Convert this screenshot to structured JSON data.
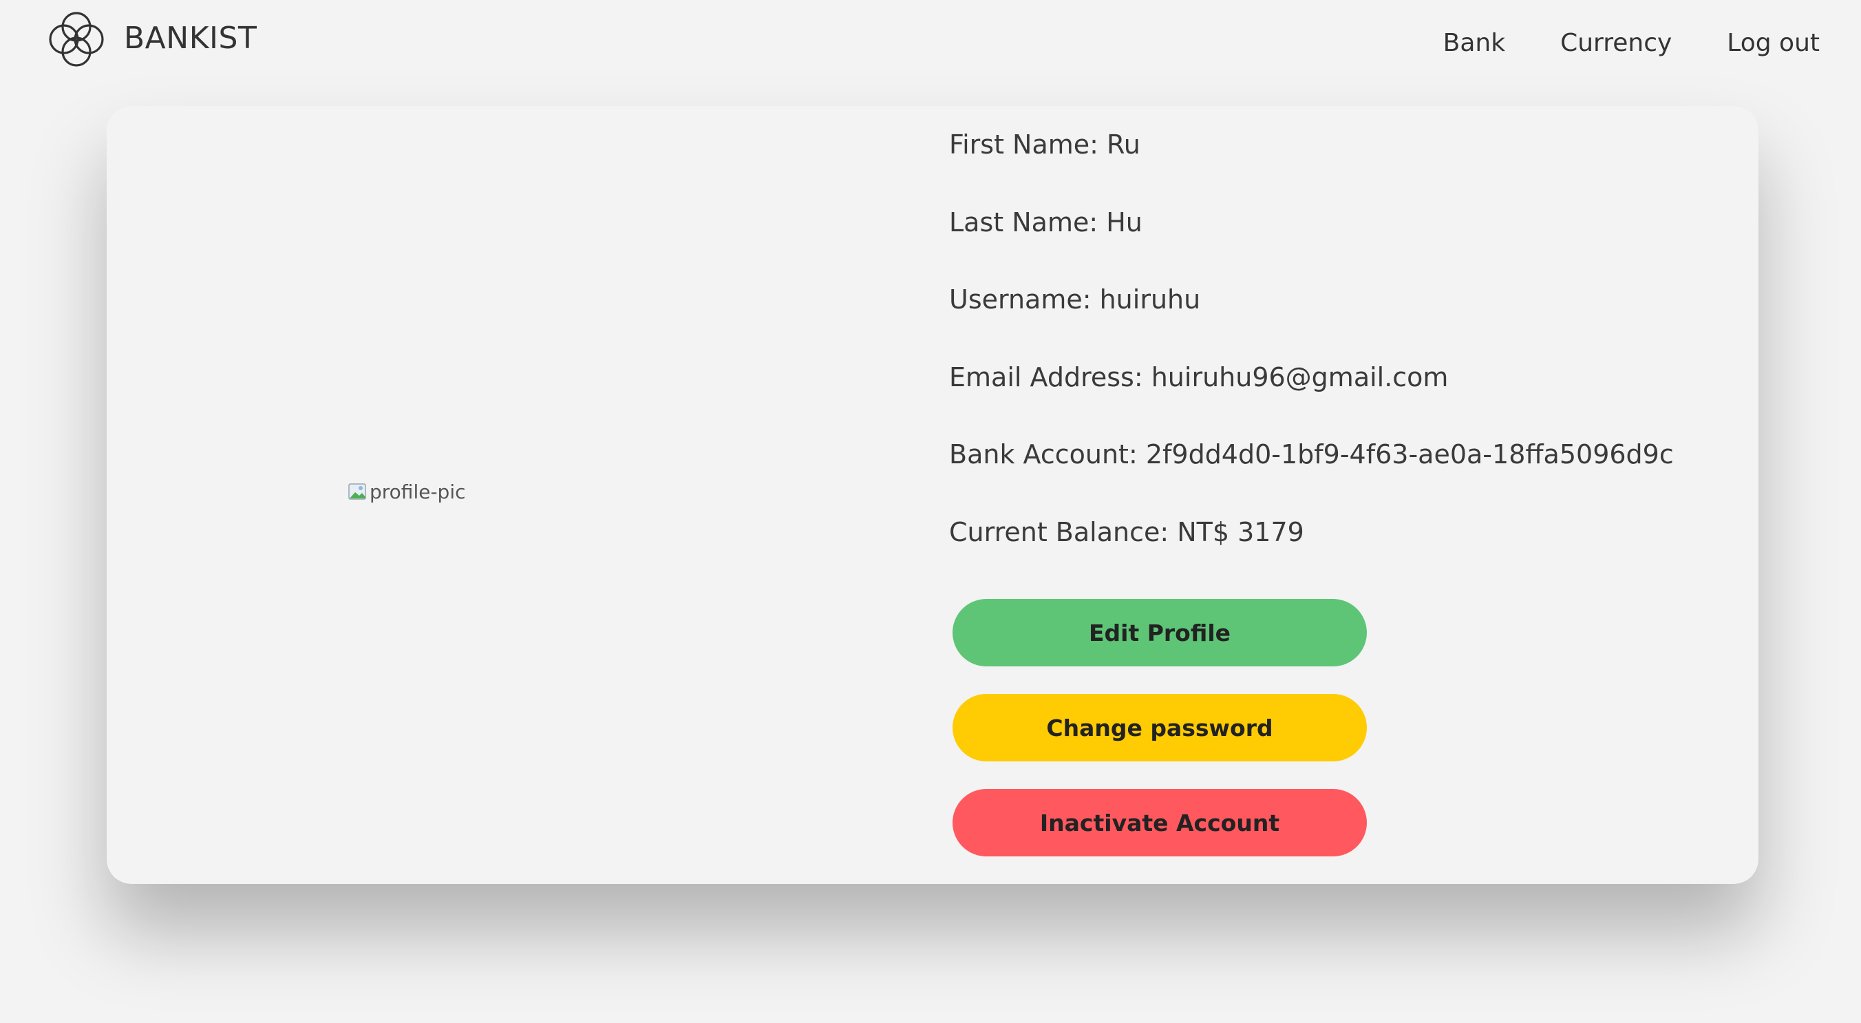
{
  "header": {
    "brand_name": "BANKIST",
    "nav": [
      {
        "label": "Bank"
      },
      {
        "label": "Currency"
      },
      {
        "label": "Log out"
      }
    ]
  },
  "profile": {
    "pic_alt": "profile-pic",
    "fields": [
      {
        "label": "First Name:",
        "value": "Ru"
      },
      {
        "label": "Last Name:",
        "value": "Hu"
      },
      {
        "label": "Username:",
        "value": "huiruhu"
      },
      {
        "label": "Email Address:",
        "value": "huiruhu96@gmail.com"
      },
      {
        "label": "Bank Account:",
        "value": "2f9dd4d0-1bf9-4f63-ae0a-18ffa5096d9c"
      },
      {
        "label": "Current Balance:",
        "value": "NT$ 3179"
      }
    ],
    "lines": [
      "First Name: Ru",
      "Last Name: Hu",
      "Username: huiruhu",
      "Email Address: huiruhu96@gmail.com",
      "Bank Account: 2f9dd4d0-1bf9-4f63-ae0a-18ffa5096d9c",
      "Current Balance: NT$ 3179"
    ]
  },
  "actions": {
    "edit_label": "Edit Profile",
    "password_label": "Change password",
    "inactivate_label": "Inactivate Account"
  },
  "colors": {
    "edit": "#5ec576",
    "password": "#ffcb03",
    "inactivate": "#ff585f",
    "background": "#f3f3f3"
  },
  "icons": {
    "logo": "bankist-logo-icon",
    "broken_image": "broken-image-icon"
  }
}
